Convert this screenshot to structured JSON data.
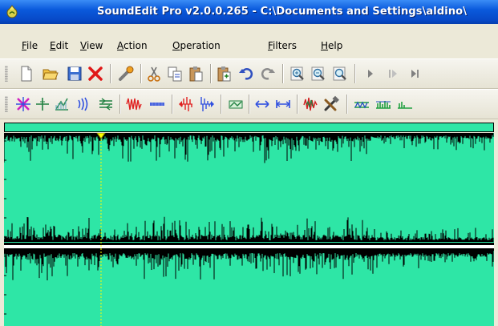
{
  "window": {
    "title": "SoundEdit Pro v2.0.0.265 - C:\\Documents and Settings\\aldino\\"
  },
  "menu": {
    "items": [
      {
        "accel": "F",
        "rest": "ile"
      },
      {
        "accel": "E",
        "rest": "dit"
      },
      {
        "accel": "V",
        "rest": "iew"
      },
      {
        "accel": "A",
        "rest": "ction"
      },
      {
        "accel": "O",
        "rest": "peration"
      },
      {
        "accel": "F",
        "rest": "ilters"
      },
      {
        "accel": "H",
        "rest": "elp"
      }
    ]
  },
  "toolbar1": {
    "icons": [
      "new-file-icon",
      "open-folder-icon",
      "save-icon",
      "delete-icon",
      "wrench-icon",
      "cut-icon",
      "copy-icon",
      "paste-icon",
      "paste-special-icon",
      "undo-icon",
      "redo-icon",
      "zoom-in-icon",
      "zoom-out-icon",
      "zoom-fit-icon",
      "play-icon",
      "play-selection-icon",
      "play-to-end-icon"
    ]
  },
  "toolbar2": {
    "icons": [
      "cross-edit-icon",
      "plus-cursor-icon",
      "amplify-icon",
      "echo-icon",
      "normalize-icon",
      "noise-icon",
      "silence-icon",
      "reverse-icon",
      "fade-icon",
      "envelope-icon",
      "stretch-icon",
      "trim-icon",
      "vocal-icon",
      "tools-icon",
      "filter-icon",
      "equalizer-icon",
      "effect-icon"
    ]
  },
  "colors": {
    "wave_background": "#2EE6A6",
    "waveform": "#000000",
    "cursor": "#FFFF00",
    "title_bar": "#0A5ADC"
  }
}
